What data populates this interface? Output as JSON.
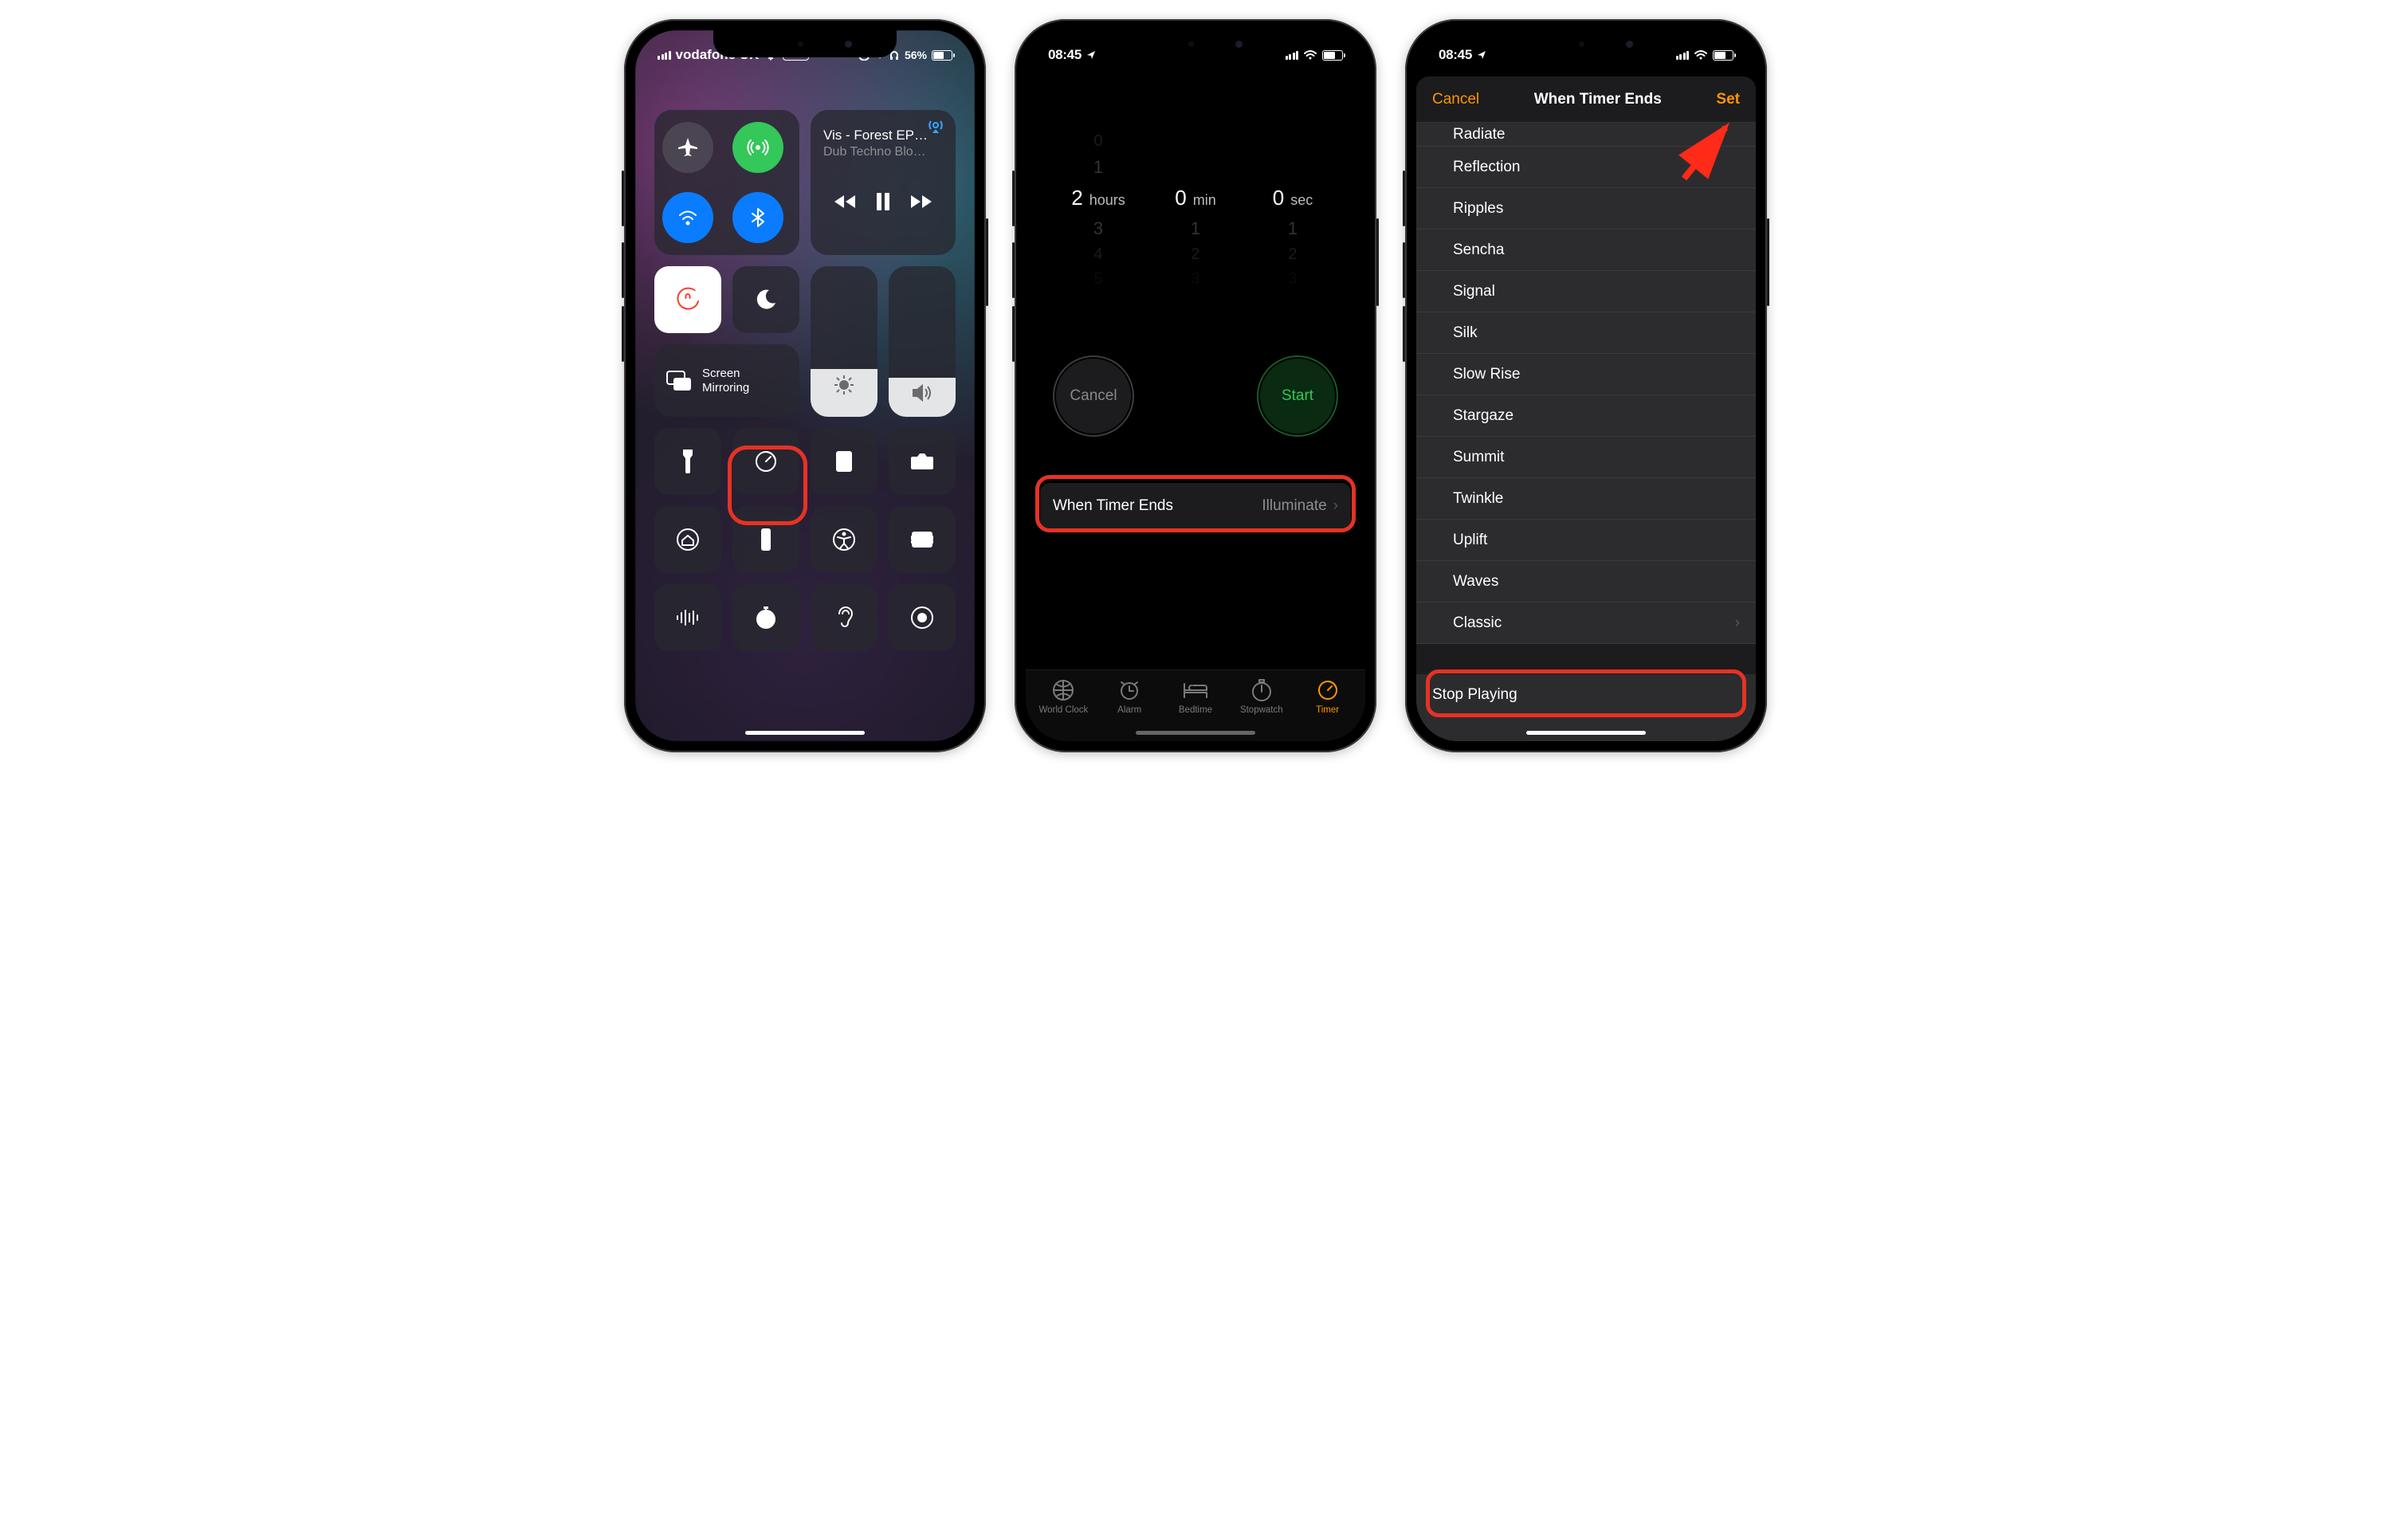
{
  "screen1": {
    "status": {
      "carrier": "vodafone UK",
      "vpn": "VPN",
      "battery_pct": "56%"
    },
    "music": {
      "title": "Vis - Forest EP…",
      "subtitle": "Dub Techno Blo…"
    },
    "mirroring_label": "Screen\nMirroring"
  },
  "screen2": {
    "time": "08:45",
    "picker": {
      "hours": {
        "above2": "0",
        "above1": "1",
        "value": "2",
        "unit": "hours",
        "below1": "3",
        "below2": "4",
        "below3": "5"
      },
      "min": {
        "value": "0",
        "unit": "min",
        "below1": "1",
        "below2": "2",
        "below3": "3"
      },
      "sec": {
        "value": "0",
        "unit": "sec",
        "below1": "1",
        "below2": "2",
        "below3": "3"
      }
    },
    "cancel": "Cancel",
    "start": "Start",
    "ends": {
      "label": "When Timer Ends",
      "value": "Illuminate"
    },
    "tabs": [
      "World Clock",
      "Alarm",
      "Bedtime",
      "Stopwatch",
      "Timer"
    ]
  },
  "screen3": {
    "time": "08:45",
    "header": {
      "cancel": "Cancel",
      "title": "When Timer Ends",
      "set": "Set"
    },
    "sounds": [
      "Radiate",
      "Reflection",
      "Ripples",
      "Sencha",
      "Signal",
      "Silk",
      "Slow Rise",
      "Stargaze",
      "Summit",
      "Twinkle",
      "Uplift",
      "Waves",
      "Classic"
    ],
    "stop": "Stop Playing"
  }
}
